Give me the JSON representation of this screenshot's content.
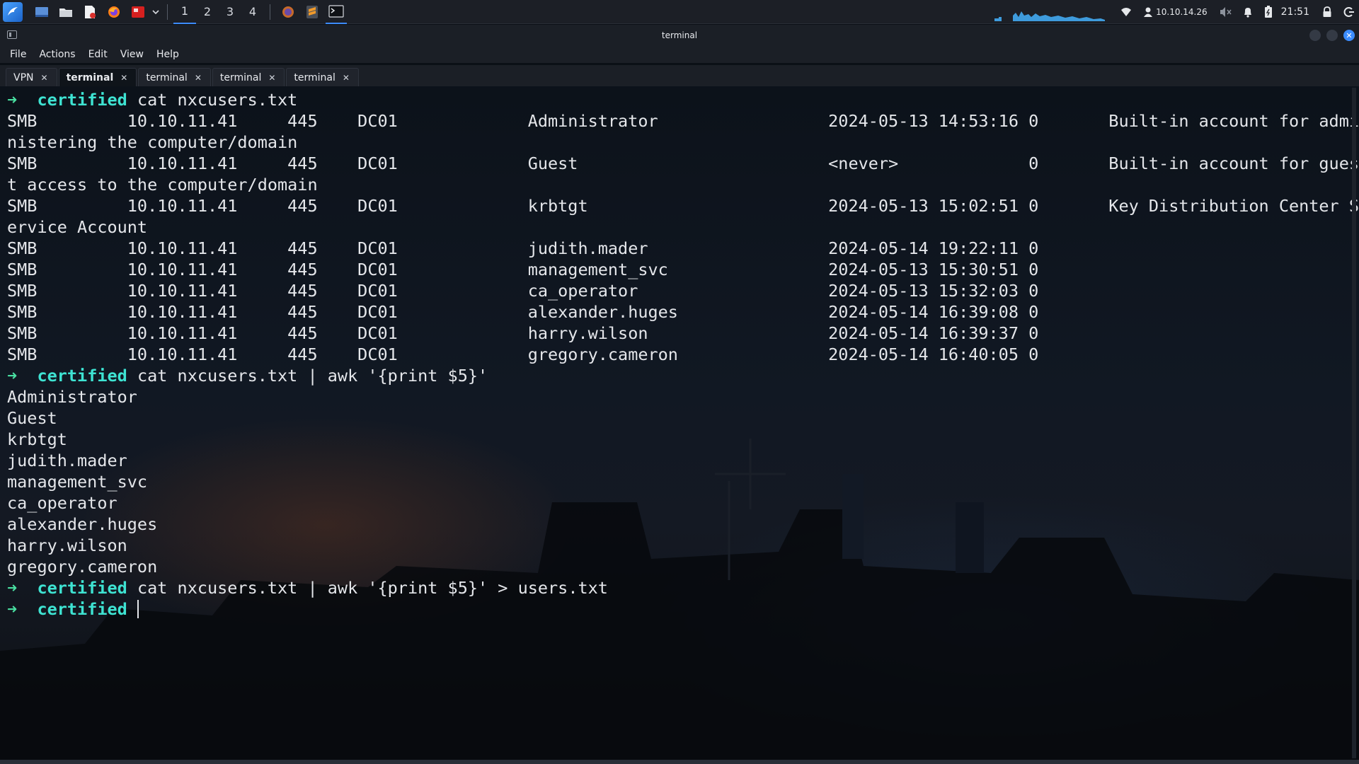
{
  "panel": {
    "workspaces": [
      "1",
      "2",
      "3",
      "4"
    ],
    "active_workspace": "1",
    "ip": "10.10.14.26",
    "clock": "21:51",
    "accent": "#3d8bff"
  },
  "window": {
    "title": "terminal"
  },
  "menubar": {
    "items": [
      "File",
      "Actions",
      "Edit",
      "View",
      "Help"
    ]
  },
  "tabs": [
    {
      "label": "VPN",
      "active": false
    },
    {
      "label": "terminal",
      "active": true
    },
    {
      "label": "terminal",
      "active": false
    },
    {
      "label": "terminal",
      "active": false
    },
    {
      "label": "terminal",
      "active": false
    }
  ],
  "terminal": {
    "prompt_arrow": "➜",
    "prompt_dir": "certified",
    "colors": {
      "arrow": "#49dfa1",
      "dir": "#3ee3d2",
      "text": "#e4e6ea"
    },
    "lines": [
      {
        "type": "prompt",
        "command": "cat nxcusers.txt"
      },
      {
        "type": "out",
        "text": "SMB         10.10.11.41     445    DC01             Administrator                 2024-05-13 14:53:16 0       Built-in account for admi"
      },
      {
        "type": "out",
        "text": "nistering the computer/domain"
      },
      {
        "type": "out",
        "text": "SMB         10.10.11.41     445    DC01             Guest                         <never>             0       Built-in account for gues"
      },
      {
        "type": "out",
        "text": "t access to the computer/domain"
      },
      {
        "type": "out",
        "text": "SMB         10.10.11.41     445    DC01             krbtgt                        2024-05-13 15:02:51 0       Key Distribution Center S"
      },
      {
        "type": "out",
        "text": "ervice Account"
      },
      {
        "type": "out",
        "text": "SMB         10.10.11.41     445    DC01             judith.mader                  2024-05-14 19:22:11 0"
      },
      {
        "type": "out",
        "text": "SMB         10.10.11.41     445    DC01             management_svc                2024-05-13 15:30:51 0"
      },
      {
        "type": "out",
        "text": "SMB         10.10.11.41     445    DC01             ca_operator                   2024-05-13 15:32:03 0"
      },
      {
        "type": "out",
        "text": "SMB         10.10.11.41     445    DC01             alexander.huges               2024-05-14 16:39:08 0"
      },
      {
        "type": "out",
        "text": "SMB         10.10.11.41     445    DC01             harry.wilson                  2024-05-14 16:39:37 0"
      },
      {
        "type": "out",
        "text": "SMB         10.10.11.41     445    DC01             gregory.cameron               2024-05-14 16:40:05 0"
      },
      {
        "type": "prompt",
        "command": "cat nxcusers.txt | awk '{print $5}'"
      },
      {
        "type": "out",
        "text": "Administrator"
      },
      {
        "type": "out",
        "text": "Guest"
      },
      {
        "type": "out",
        "text": "krbtgt"
      },
      {
        "type": "out",
        "text": "judith.mader"
      },
      {
        "type": "out",
        "text": "management_svc"
      },
      {
        "type": "out",
        "text": "ca_operator"
      },
      {
        "type": "out",
        "text": "alexander.huges"
      },
      {
        "type": "out",
        "text": "harry.wilson"
      },
      {
        "type": "out",
        "text": "gregory.cameron"
      },
      {
        "type": "prompt",
        "command": "cat nxcusers.txt | awk '{print $5}' > users.txt"
      },
      {
        "type": "prompt",
        "command": "",
        "cursor": true
      }
    ]
  }
}
